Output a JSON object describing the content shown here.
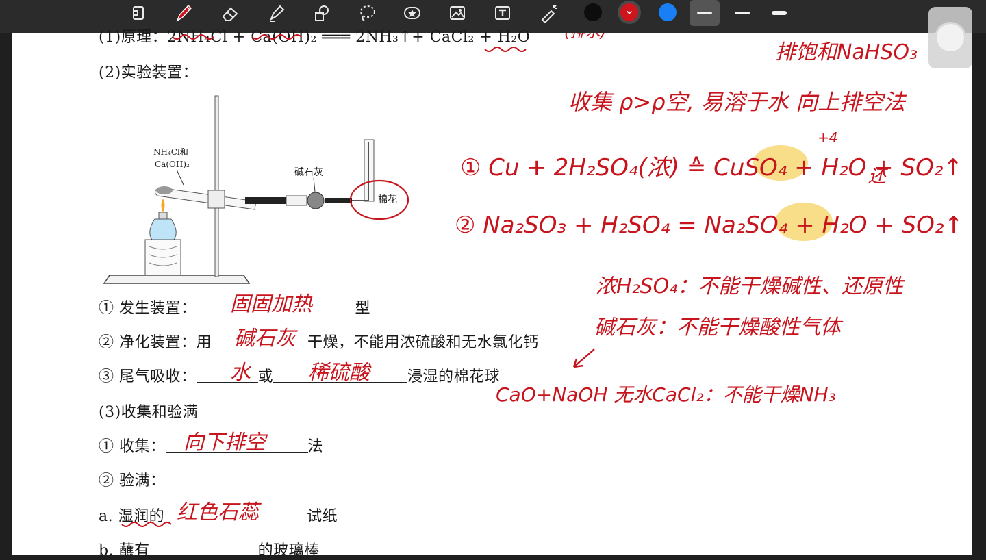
{
  "toolbar": {
    "tools": [
      "page-icon",
      "pen-icon",
      "eraser-icon",
      "highlighter-icon",
      "shapes-icon",
      "lasso-icon",
      "sticker-icon",
      "image-icon",
      "text-icon",
      "laser-pointer-icon"
    ],
    "colors": [
      "#0d0d0d",
      "#d0141c",
      "#1a7ef5"
    ],
    "selected_color": "#d0141c"
  },
  "doc": {
    "line_principle_label": "(1)原理：",
    "line_principle_eq": "2NH₄Cl + Ca(OH)₂ ═══ 2NH₃↑+ CaCl₂ + H₂O",
    "line_apparatus": "(2)实验装置：",
    "q1_prefix": "① 发生装置：",
    "q1_suffix": "型",
    "q2_prefix": "② 净化装置：用",
    "q2_suffix": "干燥，不能用浓硫酸和无水氯化钙",
    "q3_prefix": "③ 尾气吸收：",
    "q3_mid": "或",
    "q3_suffix": "浸湿的棉花球",
    "line_collect": "(3)收集和验满",
    "c1_prefix": "① 收集：",
    "c1_suffix": "法",
    "c2": "② 验满：",
    "a_prefix": "a. 湿润的",
    "a_suffix": "试纸",
    "b_prefix": "b. 蘸有",
    "b_suffix": "的玻璃棒"
  },
  "apparatus": {
    "reagent_label_1": "NH₄Cl和",
    "reagent_label_2": "Ca(OH)₂",
    "desiccant_label": "碱石灰",
    "cotton_label": "棉花"
  },
  "handwriting": {
    "top_note": "(排水)",
    "top_right": "排饱和NaHSO₃",
    "collect_note": "收集  ρ>ρ空, 易溶于水  向上排空法",
    "eq1": "① Cu + 2H₂SO₄(浓) ≙ CuSO₄ + H₂O + SO₂↑",
    "eq1_sup": "+4",
    "eq1_tail": "还",
    "eq2": "② Na₂SO₃ + H₂SO₄ = Na₂SO₄ + H₂O + SO₂↑",
    "note_h2so4": "浓H₂SO₄：不能干燥碱性、还原性",
    "note_sodalime": "碱石灰：不能干燥酸性气体",
    "note_cacl2": "CaO+NaOH  无水CaCl₂：不能干燥NH₃",
    "ans1": "固固加热",
    "ans2": "碱石灰",
    "ans3a": "水",
    "ans3b": "稀硫酸",
    "ans_collect": "向下排空",
    "ans_paper": "红色石蕊"
  }
}
